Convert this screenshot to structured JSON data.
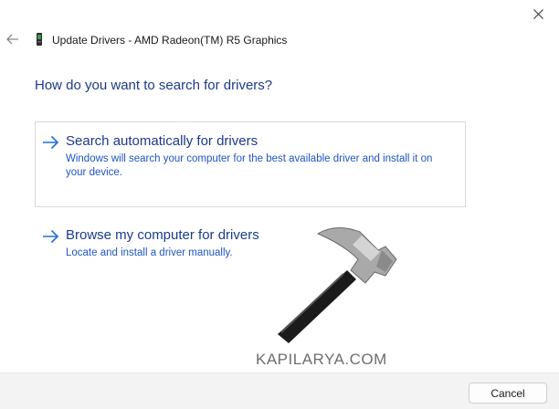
{
  "window": {
    "title": "Update Drivers - AMD Radeon(TM) R5 Graphics"
  },
  "icons": {
    "close": "close-icon",
    "back": "back-arrow-icon",
    "device": "graphics-card-icon",
    "option_arrow": "right-arrow-icon"
  },
  "main": {
    "heading": "How do you want to search for drivers?",
    "options": [
      {
        "title": "Search automatically for drivers",
        "description": "Windows will search your computer for the best available driver and install it on your device."
      },
      {
        "title": "Browse my computer for drivers",
        "description": "Locate and install a driver manually."
      }
    ]
  },
  "watermark": {
    "text": "KAPILARYA.COM"
  },
  "footer": {
    "cancel_label": "Cancel"
  },
  "colors": {
    "link": "#1c3a8a",
    "description": "#1f55c4",
    "accent_arrow": "#1f6fd8",
    "footer_bg": "#f3f3f3"
  }
}
